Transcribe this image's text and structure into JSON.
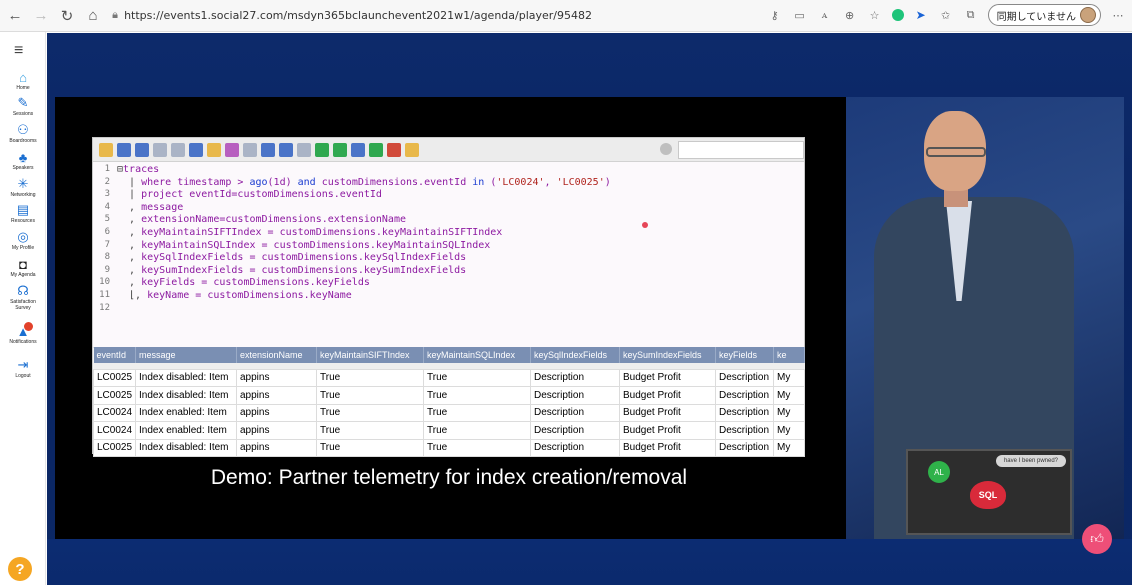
{
  "browser": {
    "url": "https://events1.social27.com/msdyn365bclaunchevent2021w1/agenda/player/95482",
    "sync_label": "同期していません"
  },
  "sidebar": {
    "items": [
      {
        "label": "Home",
        "icon": "home-icon"
      },
      {
        "label": "Sessions",
        "icon": "pen-icon"
      },
      {
        "label": "Boardrooms",
        "icon": "people-icon"
      },
      {
        "label": "Speakers",
        "icon": "speaker-icon"
      },
      {
        "label": "Networking",
        "icon": "network-icon"
      },
      {
        "label": "Resources",
        "icon": "resources-icon"
      },
      {
        "label": "My Profile",
        "icon": "profile-icon"
      },
      {
        "label": "My Agenda",
        "icon": "agenda-icon"
      },
      {
        "label": "Satisfaction Survey",
        "icon": "survey-icon"
      },
      {
        "label": "Notifications",
        "icon": "bell-icon"
      },
      {
        "label": "Logout",
        "icon": "logout-icon"
      }
    ],
    "help_label": "?"
  },
  "editor": {
    "line_numbers": [
      "1",
      "2",
      "3",
      "4",
      "5",
      "6",
      "7",
      "8",
      "9",
      "10",
      "11",
      "12"
    ],
    "lines": [
      {
        "prefix": "⊟",
        "text": "traces",
        "style": "purple"
      },
      {
        "prefix": "  | ",
        "text": "where timestamp > ago(1d) and customDimensions.eventId in ('LC0024', 'LC0025')",
        "style": "mixed"
      },
      {
        "prefix": "  | ",
        "text": "project eventId=customDimensions.eventId",
        "style": "purple"
      },
      {
        "prefix": "  , ",
        "text": "message",
        "style": "purple"
      },
      {
        "prefix": "  , ",
        "text": "extensionName=customDimensions.extensionName",
        "style": "purple"
      },
      {
        "prefix": "  , ",
        "text": "keyMaintainSIFTIndex = customDimensions.keyMaintainSIFTIndex",
        "style": "purple"
      },
      {
        "prefix": "  , ",
        "text": "keyMaintainSQLIndex = customDimensions.keyMaintainSQLIndex",
        "style": "purple"
      },
      {
        "prefix": "  , ",
        "text": "keySqlIndexFields = customDimensions.keySqlIndexFields",
        "style": "purple"
      },
      {
        "prefix": "  , ",
        "text": "keySumIndexFields = customDimensions.keySumIndexFields",
        "style": "purple"
      },
      {
        "prefix": "  , ",
        "text": "keyFields = customDimensions.keyFields",
        "style": "purple"
      },
      {
        "prefix": "  ⌊, ",
        "text": "keyName = customDimensions.keyName",
        "style": "purple"
      },
      {
        "prefix": "",
        "text": "",
        "style": "purple"
      }
    ]
  },
  "grid": {
    "columns": [
      "eventId",
      "message",
      "extensionName",
      "keyMaintainSIFTIndex",
      "keyMaintainSQLIndex",
      "keySqlIndexFields",
      "keySumIndexFields",
      "keyFields",
      "ke"
    ],
    "rows": [
      [
        "LC0025",
        "Index disabled: Item",
        "appins",
        "True",
        "True",
        "Description",
        "Budget Profit",
        "Description",
        "My"
      ],
      [
        "LC0025",
        "Index disabled: Item",
        "appins",
        "True",
        "True",
        "Description",
        "Budget Profit",
        "Description",
        "My"
      ],
      [
        "LC0024",
        "Index enabled: Item",
        "appins",
        "True",
        "True",
        "Description",
        "Budget Profit",
        "Description",
        "My"
      ],
      [
        "LC0024",
        "Index enabled: Item",
        "appins",
        "True",
        "True",
        "Description",
        "Budget Profit",
        "Description",
        "My"
      ],
      [
        "LC0025",
        "Index disabled: Item",
        "appins",
        "True",
        "True",
        "Description",
        "Budget Profit",
        "Description",
        "My"
      ]
    ]
  },
  "video": {
    "caption": "Demo: Partner telemetry for index creation/removal"
  },
  "presenter": {
    "sticker_sql": "SQL",
    "sticker_al": "AL",
    "sticker_pill": "have I been pwned?"
  },
  "colors": {
    "stage": "#0b2866",
    "accent_like": "#ee4f78",
    "help": "#f5a623",
    "sidebar_icon": "#1b6fd1"
  }
}
